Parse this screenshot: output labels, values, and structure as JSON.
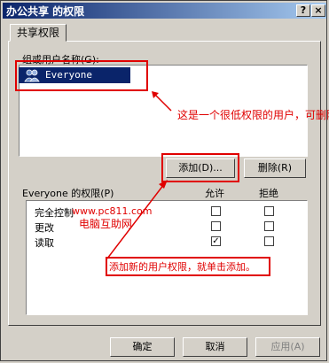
{
  "window": {
    "title": "办公共享 的权限",
    "help_btn": "?",
    "close_btn": "×"
  },
  "tab": {
    "label": "共享权限"
  },
  "group_label": "组或用户名称(G):",
  "users": [
    "Everyone"
  ],
  "annotations": {
    "user_note": "这是一个很低权限的用户，可删除",
    "watermark_url": "www.pc811.com",
    "watermark_name": "电脑互助网",
    "add_note": "添加新的用户权限，就单击添加。"
  },
  "buttons": {
    "add": "添加(D)...",
    "remove": "删除(R)",
    "ok": "确定",
    "cancel": "取消",
    "apply": "应用(A)"
  },
  "permissions": {
    "header": "Everyone 的权限(P)",
    "allow": "允许",
    "deny": "拒绝",
    "rows": [
      {
        "name": "完全控制",
        "allow": false,
        "deny": false
      },
      {
        "name": "更改",
        "allow": false,
        "deny": false
      },
      {
        "name": "读取",
        "allow": true,
        "deny": false
      }
    ]
  },
  "colors": {
    "title_bar": "#0a246a",
    "annotation": "#e00000",
    "selection": "#0a246a"
  }
}
